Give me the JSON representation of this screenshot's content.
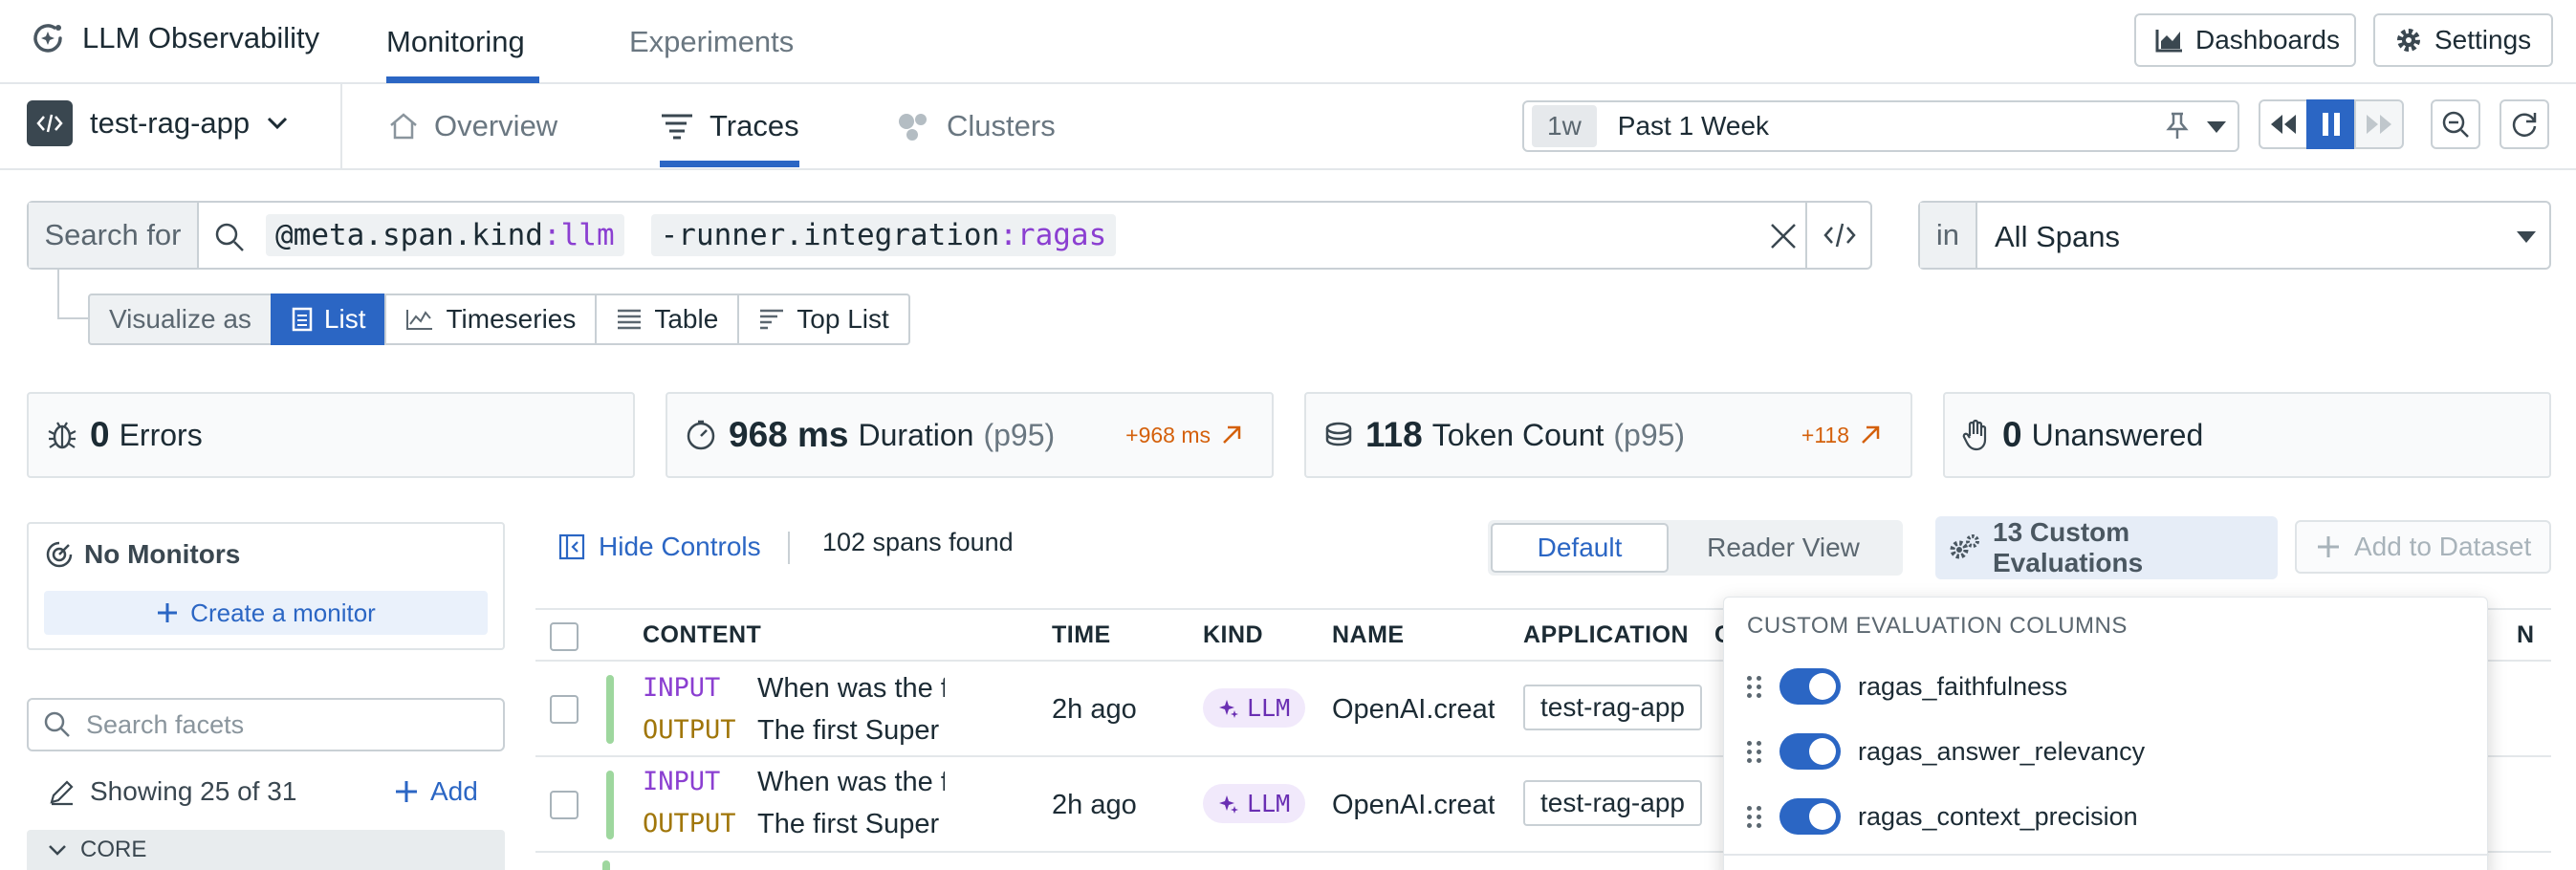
{
  "app": {
    "title": "LLM Observability"
  },
  "top_tabs": [
    "Monitoring",
    "Experiments"
  ],
  "top_actions": {
    "dashboards": "Dashboards",
    "settings": "Settings"
  },
  "app_selector": {
    "name": "test-rag-app"
  },
  "sub_tabs": [
    "Overview",
    "Traces",
    "Clusters"
  ],
  "time": {
    "badge": "1w",
    "label": "Past 1 Week"
  },
  "search": {
    "label": "Search for",
    "term1_key": "@meta.span.kind",
    "term1_sep": ":",
    "term1_val": "llm",
    "term2_key": "-runner.integration",
    "term2_sep": ":",
    "term2_val": "ragas"
  },
  "scope": {
    "label": "in",
    "value": "All Spans"
  },
  "visualize": {
    "label": "Visualize as",
    "options": [
      "List",
      "Timeseries",
      "Table",
      "Top List"
    ],
    "selected": "List"
  },
  "stats": {
    "errors": {
      "value": "0",
      "label": "Errors"
    },
    "duration": {
      "value": "968 ms",
      "label": "Duration",
      "qual": "(p95)",
      "delta": "+968 ms"
    },
    "tokens": {
      "value": "118",
      "label": "Token Count",
      "qual": "(p95)",
      "delta": "+118"
    },
    "unanswered": {
      "value": "0",
      "label": "Unanswered"
    }
  },
  "monitors": {
    "title": "No Monitors",
    "create": "Create a monitor"
  },
  "facets": {
    "placeholder": "Search facets",
    "showing": "Showing 25 of 31",
    "add": "Add",
    "section": "CORE"
  },
  "controls": {
    "hide": "Hide Controls",
    "count": "102 spans found",
    "view_default": "Default",
    "view_reader": "Reader View",
    "custom_evals": "13 Custom Evaluations",
    "add_dataset": "Add to Dataset"
  },
  "table": {
    "headers": [
      "CONTENT",
      "TIME",
      "KIND",
      "NAME",
      "APPLICATION",
      "C",
      "N"
    ],
    "rows": [
      {
        "input_label": "INPUT",
        "input": "When was the first s...",
        "output_label": "OUTPUT",
        "output": "The first Super Bowl...",
        "time": "2h  ago",
        "kind": "LLM",
        "name": "OpenAI.createC",
        "app": "test-rag-app"
      },
      {
        "input_label": "INPUT",
        "input": "When was the first s...",
        "output_label": "OUTPUT",
        "output": "The first Super Bowl...",
        "time": "2h  ago",
        "kind": "LLM",
        "name": "OpenAI.createC",
        "app": "test-rag-app"
      }
    ]
  },
  "eval_popup": {
    "title": "CUSTOM EVALUATION COLUMNS",
    "items": [
      "ragas_faithfulness",
      "ragas_answer_relevancy",
      "ragas_context_precision"
    ]
  },
  "colors": {
    "accent": "#2b66c4",
    "input_label": "#8b3fd1",
    "output_label": "#a0760a",
    "delta": "#d4600b",
    "row_bar": "#9ed79e"
  }
}
